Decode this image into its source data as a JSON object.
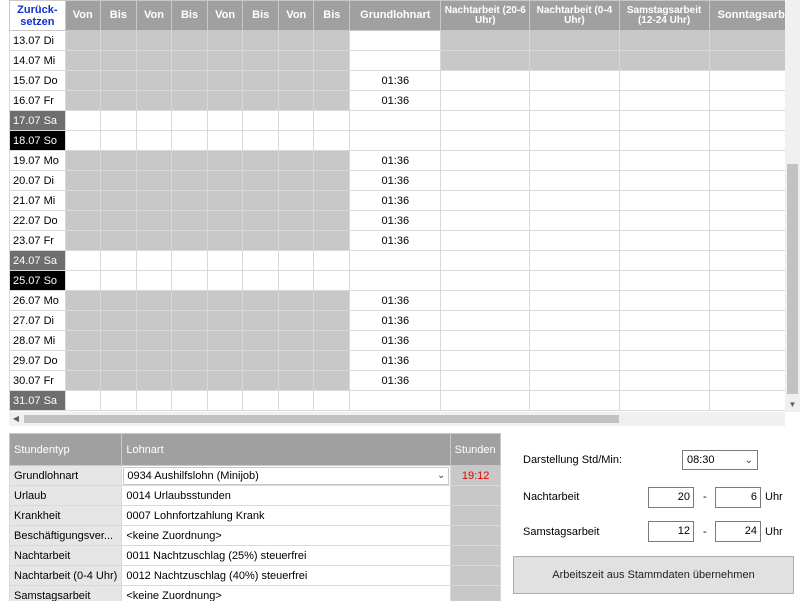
{
  "grid": {
    "reset_label_1": "Zurück-",
    "reset_label_2": "setzen",
    "headers": [
      "Von",
      "Bis",
      "Von",
      "Bis",
      "Von",
      "Bis",
      "Von",
      "Bis"
    ],
    "col_grundlohnart": "Grundlohnart",
    "col_nacht_20_6": "Nachtarbeit (20-6 Uhr)",
    "col_nacht_0_4": "Nachtarbeit (0-4 Uhr)",
    "col_samstag": "Samstagsarbeit (12-24 Uhr)",
    "col_sonntag": "Sonntagsarb",
    "rows": [
      {
        "date": "13.07 Di",
        "kind": "weekday",
        "grund": ""
      },
      {
        "date": "14.07 Mi",
        "kind": "weekday",
        "grund": ""
      },
      {
        "date": "15.07 Do",
        "kind": "weekday",
        "grund": "01:36"
      },
      {
        "date": "16.07 Fr",
        "kind": "weekday",
        "grund": "01:36"
      },
      {
        "date": "17.07 Sa",
        "kind": "sat",
        "grund": ""
      },
      {
        "date": "18.07 So",
        "kind": "sun",
        "grund": ""
      },
      {
        "date": "19.07 Mo",
        "kind": "weekday",
        "grund": "01:36"
      },
      {
        "date": "20.07 Di",
        "kind": "weekday",
        "grund": "01:36"
      },
      {
        "date": "21.07 Mi",
        "kind": "weekday",
        "grund": "01:36"
      },
      {
        "date": "22.07 Do",
        "kind": "weekday",
        "grund": "01:36"
      },
      {
        "date": "23.07 Fr",
        "kind": "weekday",
        "grund": "01:36"
      },
      {
        "date": "24.07 Sa",
        "kind": "sat",
        "grund": ""
      },
      {
        "date": "25.07 So",
        "kind": "sun",
        "grund": ""
      },
      {
        "date": "26.07 Mo",
        "kind": "weekday",
        "grund": "01:36"
      },
      {
        "date": "27.07 Di",
        "kind": "weekday",
        "grund": "01:36"
      },
      {
        "date": "28.07 Mi",
        "kind": "weekday",
        "grund": "01:36"
      },
      {
        "date": "29.07 Do",
        "kind": "weekday",
        "grund": "01:36"
      },
      {
        "date": "30.07 Fr",
        "kind": "weekday",
        "grund": "01:36"
      },
      {
        "date": "31.07 Sa",
        "kind": "sat",
        "grund": ""
      }
    ]
  },
  "lower": {
    "col_stundentyp": "Stundentyp",
    "col_lohnart": "Lohnart",
    "col_stunden": "Stunden",
    "rows": [
      {
        "typ": "Grundlohnart",
        "lohnart": "0934 Aushilfslohn (Minijob)",
        "stunden": "19:12",
        "dropdown": true
      },
      {
        "typ": "Urlaub",
        "lohnart": "0014 Urlaubsstunden",
        "stunden": ""
      },
      {
        "typ": "Krankheit",
        "lohnart": "0007 Lohnfortzahlung Krank",
        "stunden": ""
      },
      {
        "typ": "Beschäftigungsver...",
        "lohnart": "<keine Zuordnung>",
        "stunden": ""
      },
      {
        "typ": "Nachtarbeit",
        "lohnart": "0011 Nachtzuschlag (25%) steuerfrei",
        "stunden": ""
      },
      {
        "typ": "Nachtarbeit (0-4 Uhr)",
        "lohnart": "0012 Nachtzuschlag (40%) steuerfrei",
        "stunden": ""
      },
      {
        "typ": "Samstagsarbeit",
        "lohnart": "<keine Zuordnung>",
        "stunden": ""
      }
    ]
  },
  "settings": {
    "darstellung_label": "Darstellung Std/Min:",
    "darstellung_value": "08:30",
    "nacht_label": "Nachtarbeit",
    "nacht_from": "20",
    "nacht_to": "6",
    "samstag_label": "Samstagsarbeit",
    "samstag_from": "12",
    "samstag_to": "24",
    "dash": "-",
    "unit": "Uhr",
    "apply_button": "Arbeitszeit aus Stammdaten übernehmen"
  }
}
